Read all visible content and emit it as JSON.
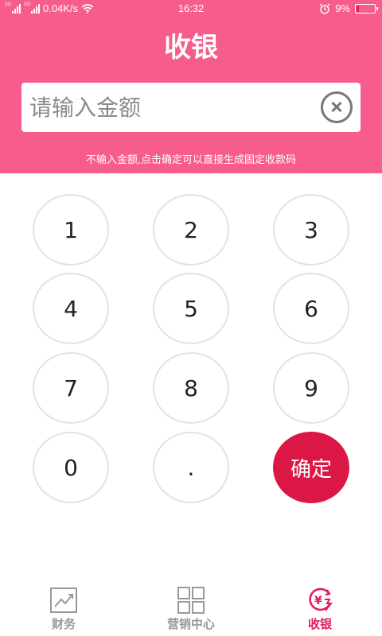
{
  "status_bar": {
    "network_type_1": "2G",
    "network_type_2": "3G",
    "speed": "0.04K/s",
    "time": "16:32",
    "battery": "9%",
    "icons": [
      "signal-icon",
      "wifi-icon",
      "alarm-icon",
      "battery-icon"
    ]
  },
  "header": {
    "title": "收银",
    "amount_placeholder": "请输入金额",
    "amount_value": "",
    "hint": "不输入金额,点击确定可以直接生成固定收款码"
  },
  "keypad": {
    "k1": "1",
    "k2": "2",
    "k3": "3",
    "k4": "4",
    "k5": "5",
    "k6": "6",
    "k7": "7",
    "k8": "8",
    "k9": "9",
    "k0": "0",
    "dot": ".",
    "confirm": "确定"
  },
  "tabbar": {
    "finance": "财务",
    "marketing": "营销中心",
    "cashier": "收银",
    "active": "cashier"
  },
  "colors": {
    "header_bg": "#f65d8d",
    "confirm_bg": "#db1745",
    "active_tab": "#e8175d",
    "inactive_tab": "#999999"
  }
}
